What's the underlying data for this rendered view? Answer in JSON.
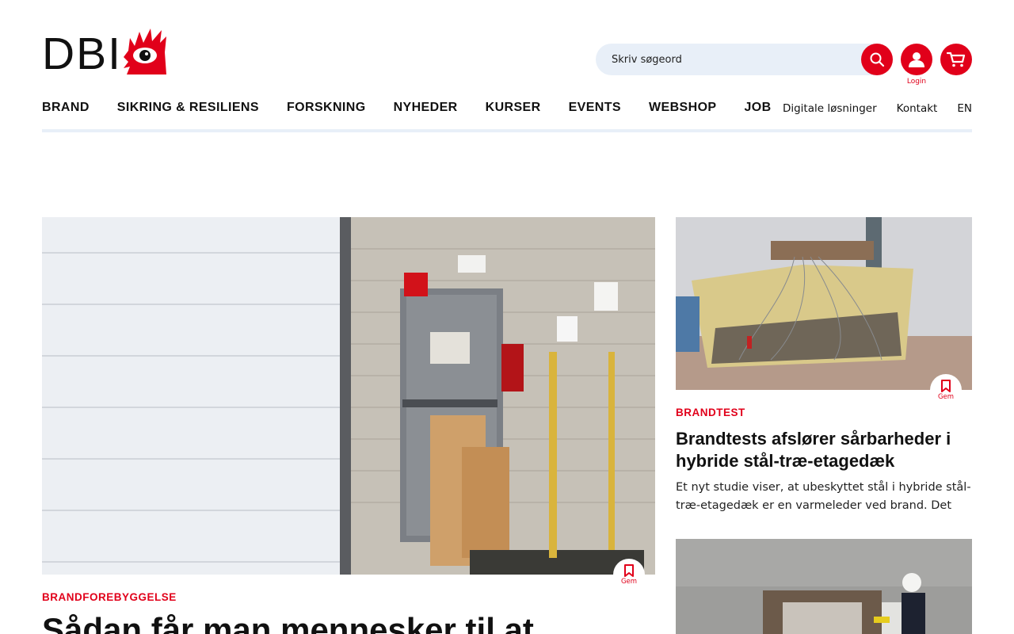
{
  "header": {
    "logo_text": "DBI",
    "search": {
      "placeholder": "Skriv søgeord"
    },
    "login_label": "Login"
  },
  "nav": {
    "main": [
      "BRAND",
      "SIKRING & RESILIENS",
      "FORSKNING",
      "NYHEDER",
      "KURSER",
      "EVENTS",
      "WEBSHOP",
      "JOB"
    ],
    "utility": [
      "Digitale løsninger",
      "Kontakt",
      "EN"
    ]
  },
  "articles": {
    "hero": {
      "category": "BRANDFOREBYGGELSE",
      "title": "Sådan får man mennesker til at",
      "save_label": "Gem"
    },
    "side1": {
      "category": "BRANDTEST",
      "title": "Brandtests afslører sårbarheder i hybride stål-træ-etagedæk",
      "teaser": "Et nyt studie viser, at ubeskyttet stål i hybride stål-træ-etagedæk er en varmeleder ved brand. Det kan…",
      "save_label": "Gem"
    }
  },
  "colors": {
    "brand_red": "#e1001a",
    "search_bg": "#e8eff8",
    "text": "#111111"
  },
  "icons": {
    "search": "search-icon",
    "login": "user-icon",
    "cart": "cart-icon",
    "save": "bookmark-icon",
    "logo_mark": "flame-eye-icon"
  }
}
